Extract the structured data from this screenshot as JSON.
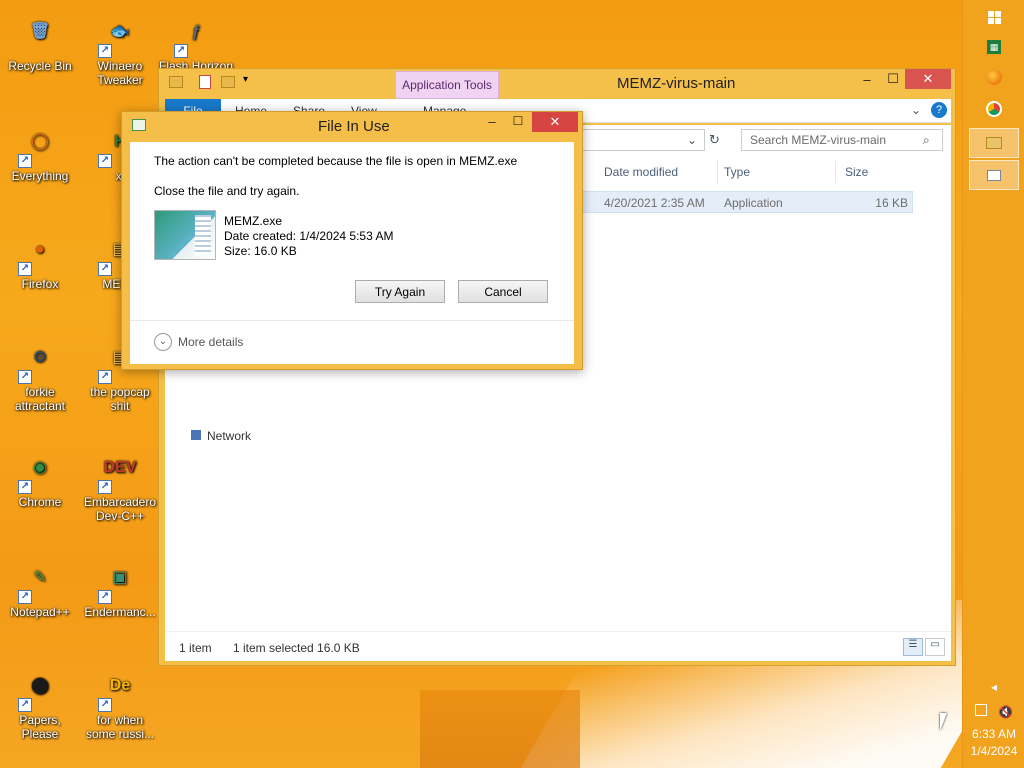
{
  "desktop": {
    "icons": [
      {
        "label": "Recycle Bin",
        "glyph": "🗑",
        "color": "#7aa7d8"
      },
      {
        "label": "Winaero Tweaker",
        "glyph": "🐟",
        "color": "#1f3a7a"
      },
      {
        "label": "Flash Horizon",
        "glyph": "ƒ",
        "color": "#5a6b7a"
      },
      {
        "label": "Everything",
        "glyph": "◯",
        "color": "#e86a1a"
      },
      {
        "label": "xi",
        "glyph": "H",
        "color": "#2b8a3e"
      },
      {
        "label": "Firefox",
        "glyph": "●",
        "color": "#e66000"
      },
      {
        "label": "MEMZ",
        "glyph": "▤",
        "color": "#f2c14e"
      },
      {
        "label": "forkie attractant",
        "glyph": "⚙",
        "color": "#2a4e7a"
      },
      {
        "label": "the popcap shit",
        "glyph": "▤",
        "color": "#f2c14e"
      },
      {
        "label": "Chrome",
        "glyph": "◉",
        "color": "#2a8f4a"
      },
      {
        "label": "Embarcadero Dev-C++",
        "glyph": "DEV",
        "color": "#c0392b"
      },
      {
        "label": "Notepad++",
        "glyph": "✎",
        "color": "#6aa84f"
      },
      {
        "label": "Endermanc...",
        "glyph": "▣",
        "color": "#3b8f76"
      },
      {
        "label": "Papers, Please",
        "glyph": "⬤",
        "color": "#1a1a1a"
      },
      {
        "label": "for when some russi...",
        "glyph": "De",
        "color": "#f5b800"
      }
    ]
  },
  "explorer": {
    "title": "MEMZ-virus-main",
    "app_tools_tab": "Application Tools",
    "ribbon_tabs": [
      "File",
      "Home",
      "Share",
      "View",
      "Manage"
    ],
    "search_placeholder": "Search MEMZ-virus-main",
    "columns": [
      "Date modified",
      "Type",
      "Size"
    ],
    "file": {
      "date_modified": "4/20/2021 2:35 AM",
      "type": "Application",
      "size": "16 KB"
    },
    "nav_network": "Network",
    "status_items": "1 item",
    "status_selected": "1 item selected  16.0 KB"
  },
  "dialog": {
    "title": "File In Use",
    "message": "The action can't be completed because the file is open in MEMZ.exe",
    "instruction": "Close the file and try again.",
    "file_name": "MEMZ.exe",
    "date_created": "Date created: 1/4/2024 5:53 AM",
    "size": "Size: 16.0 KB",
    "try_again_label": "Try Again",
    "cancel_label": "Cancel",
    "more_details_label": "More details"
  },
  "taskbar": {
    "time": "6:33 AM",
    "date": "1/4/2024"
  }
}
